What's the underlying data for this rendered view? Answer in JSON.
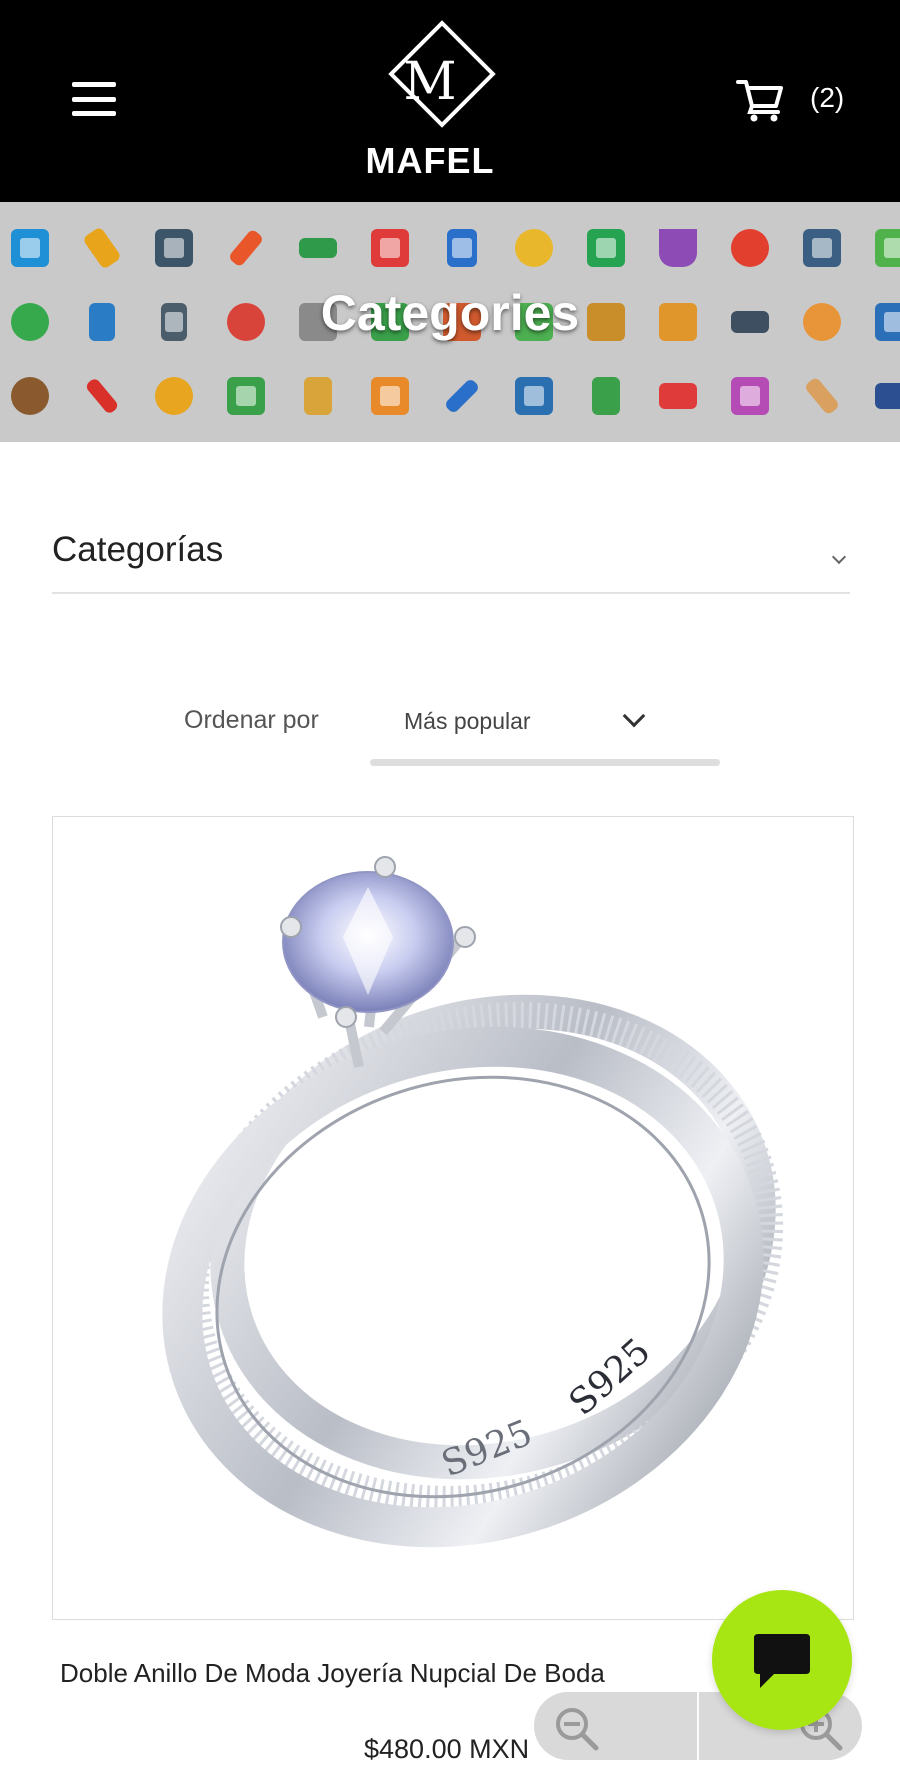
{
  "header": {
    "brand_letter": "M",
    "brand_name": "MAFEL",
    "cart_count": "(2)",
    "background": "#000000"
  },
  "banner": {
    "title": "Categories",
    "background": "#c9c9c9"
  },
  "filters": {
    "categories_label": "Categorías",
    "sort_label": "Ordenar por",
    "sort_value": "Más popular"
  },
  "product": {
    "name": "Doble Anillo De Moda Joyería Nupcial De Boda",
    "price": "$480.00 MXN",
    "engraving": "S925"
  },
  "colors": {
    "chat_button": "#a7e612",
    "accent_text": "#222222"
  },
  "icons": {
    "menu": "hamburger-menu-icon",
    "cart": "shopping-cart-icon",
    "chat": "chat-bubble-icon",
    "zoom_out": "zoom-out-icon",
    "zoom_in": "zoom-in-icon"
  }
}
